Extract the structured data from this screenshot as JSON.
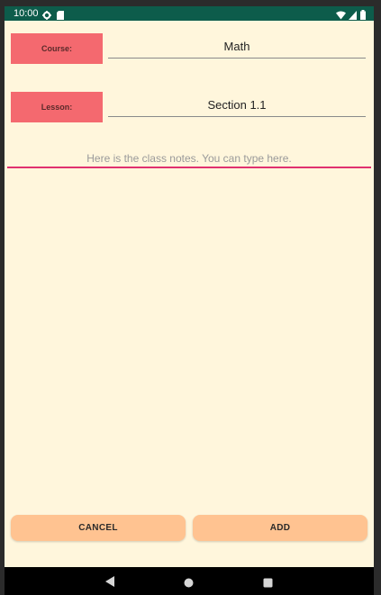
{
  "status_bar": {
    "time": "10:00",
    "left_icons": [
      "settings-gear-icon",
      "sd-card-icon"
    ],
    "right_icons": [
      "wifi-icon",
      "cellular-signal-icon",
      "battery-icon"
    ],
    "background": "#0d5c4b"
  },
  "form": {
    "course_label": "Course:",
    "course_value": "Math",
    "lesson_label": "Lesson:",
    "lesson_value": "Section 1.1",
    "notes_placeholder": "Here is the class notes. You can type here."
  },
  "buttons": {
    "cancel_label": "CANCEL",
    "add_label": "ADD"
  },
  "nav_bar": {
    "icons": [
      "back-triangle-icon",
      "home-circle-icon",
      "recents-square-icon"
    ]
  },
  "colors": {
    "background": "#fff6dc",
    "label_box": "#f4696f",
    "button": "#ffc391",
    "notes_underline": "#e0316f"
  }
}
